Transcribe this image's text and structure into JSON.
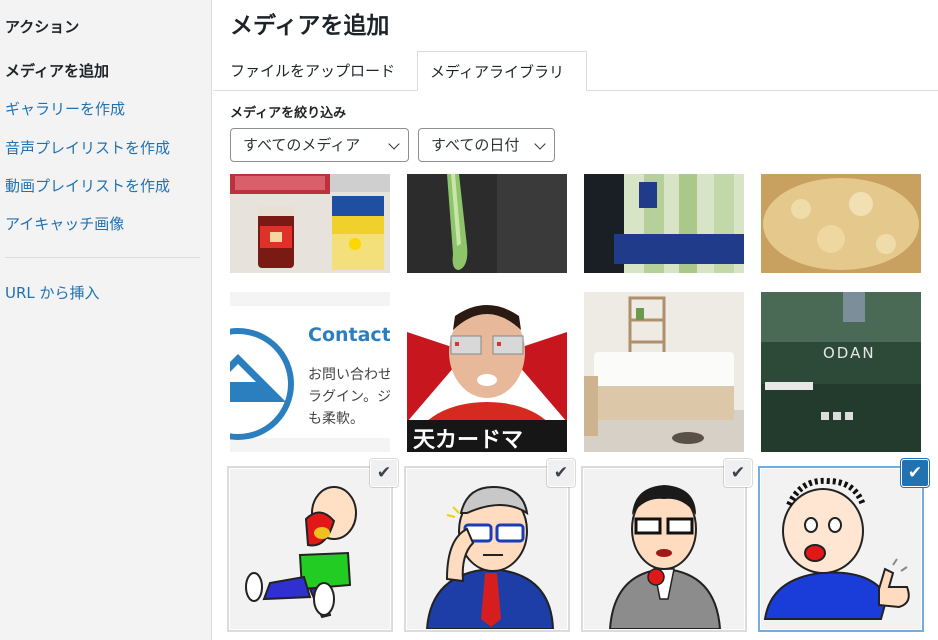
{
  "sidebar": {
    "heading": "アクション",
    "items": [
      {
        "label": "メディアを追加",
        "active": true
      },
      {
        "label": "ギャラリーを作成"
      },
      {
        "label": "音声プレイリストを作成"
      },
      {
        "label": "動画プレイリストを作成"
      },
      {
        "label": "アイキャッチ画像"
      }
    ],
    "url_insert": "URL から挿入"
  },
  "main": {
    "title": "メディアを追加",
    "tabs": [
      {
        "label": "ファイルをアップロード"
      },
      {
        "label": "メディアライブラリ",
        "active": true
      }
    ],
    "filter_label": "メディアを絞り込み",
    "media_filter": "すべてのメディア",
    "date_filter": "すべての日付"
  },
  "grid": {
    "thumbs": [
      {
        "subject": "food-jars"
      },
      {
        "subject": "green-onion"
      },
      {
        "subject": "packaged-vegetables"
      },
      {
        "subject": "fried-crumbs"
      },
      {
        "subject": "contact-form-screenshot",
        "text_title": "Contact F",
        "text_lines": [
          "お問い合わせ",
          "ラグイン。ジ",
          "も柔軟。"
        ]
      },
      {
        "subject": "card-man",
        "banner_text": "天カードマ"
      },
      {
        "subject": "bedroom"
      },
      {
        "subject": "grass-website",
        "logo_text": "ODAN"
      },
      {
        "subject": "cartoon-crying-man",
        "selected": true
      },
      {
        "subject": "cartoon-glasses-businessman",
        "selected": true
      },
      {
        "subject": "cartoon-old-man-suit",
        "selected": true
      },
      {
        "subject": "cartoon-thumbs-up-man",
        "selected": true,
        "focused": true
      }
    ],
    "check_mark": "✔"
  },
  "colors": {
    "accent": "#2271b1",
    "focus": "#72aee6",
    "text": "#1d2327",
    "sidebar_bg": "#f3f3f3"
  }
}
